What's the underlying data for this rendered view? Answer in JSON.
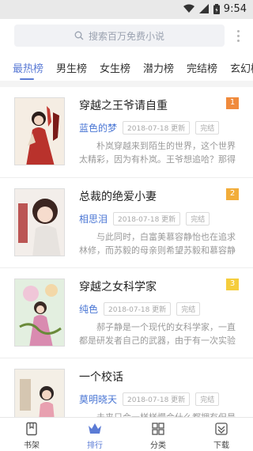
{
  "status_bar": {
    "time": "9:54"
  },
  "search": {
    "placeholder": "搜索百万免费小说"
  },
  "tabs": [
    {
      "label": "最热榜"
    },
    {
      "label": "男生榜"
    },
    {
      "label": "女生榜"
    },
    {
      "label": "潜力榜"
    },
    {
      "label": "完结榜"
    },
    {
      "label": "玄幻榜"
    }
  ],
  "books": [
    {
      "title": "穿越之王爷请自重",
      "rank": "1",
      "rank_color": "#f08a3c",
      "author": "蓝色的梦",
      "updated": "2018-07-18 更新",
      "status": "完结",
      "description": "朴岚穿越来到陌生的世界，这个世界太精彩，因为有朴岚。王爷想追哈？那得看哈！"
    },
    {
      "title": "总裁的绝爱小妻",
      "rank": "2",
      "rank_color": "#f2ad3a",
      "author": "相思泪",
      "updated": "2018-07-18 更新",
      "status": "完结",
      "description": "与此同时，白富美慕容静怡也在追求林修，而苏毅的母亲则希望苏毅和慕容静怡..."
    },
    {
      "title": "穿越之女科学家",
      "rank": "3",
      "rank_color": "#f5cd3c",
      "author": "纯色",
      "updated": "2018-07-18 更新",
      "status": "完结",
      "description": "郝子静是一个现代的女科学家，一直都是研发者自己的武器，由于有一次实验室没..."
    },
    {
      "title": "一个校话",
      "rank": "",
      "rank_color": "",
      "author": "莫明晓天",
      "updated": "2018-07-18 更新",
      "status": "完结",
      "description": "未来只会一样样慢会什么都拥有但是就是"
    }
  ],
  "bottom_nav": [
    {
      "label": "书架"
    },
    {
      "label": "排行"
    },
    {
      "label": "分类"
    },
    {
      "label": "下载"
    }
  ],
  "colors": {
    "accent": "#5b7bd5",
    "author": "#4a76d4"
  }
}
